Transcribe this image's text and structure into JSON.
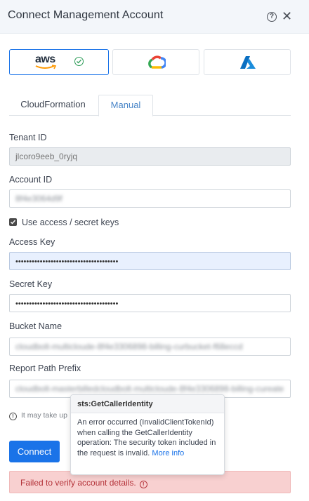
{
  "header": {
    "title": "Connect Management Account",
    "help_icon": "question-circle-icon",
    "close_icon": "close-icon",
    "help_glyph": "?",
    "close_glyph": "✕"
  },
  "providers": [
    {
      "name": "aws",
      "logo_text": "aws",
      "selected": true,
      "status_icon": "check-circle-icon"
    },
    {
      "name": "gcp",
      "selected": false
    },
    {
      "name": "azure",
      "selected": false
    }
  ],
  "tabs": [
    {
      "label": "CloudFormation",
      "active": false
    },
    {
      "label": "Manual",
      "active": true
    }
  ],
  "form": {
    "tenant_id": {
      "label": "Tenant ID",
      "value": "jlcoro9eeb_0ryjq"
    },
    "account_id": {
      "label": "Account ID",
      "value": "8f4e3064d9f"
    },
    "use_keys": {
      "label": "Use access / secret keys",
      "checked": true
    },
    "access_key": {
      "label": "Access Key",
      "value": "••••••••••••••••••••••••••••••••••••••"
    },
    "secret_key": {
      "label": "Secret Key",
      "value": "••••••••••••••••••••••••••••••••••••••"
    },
    "bucket_name": {
      "label": "Bucket Name",
      "value": "cloudbolt-multicloude-8f4e3306898-billing-curbucket-f68eccd"
    },
    "report_path_prefix": {
      "label": "Report Path Prefix",
      "value": "cloudbolt-masterbilledcloudbolt-multicloude-8f4e3306898-billing-cureate"
    }
  },
  "info_note": "It may take up",
  "connect_label": "Connect",
  "error": {
    "message": "Failed to verify account details.",
    "icon": "info-circle-icon"
  },
  "tooltip": {
    "title": "sts:GetCallerIdentity",
    "body": "An error occurred (InvalidClientTokenId) when calling the GetCallerIdentity operation: The security token included in the request is invalid.",
    "link": "More info"
  },
  "colors": {
    "accent": "#1a73e8",
    "success": "#2e9c59",
    "error_bg": "#f8d0d0",
    "error_text": "#b4333a"
  }
}
